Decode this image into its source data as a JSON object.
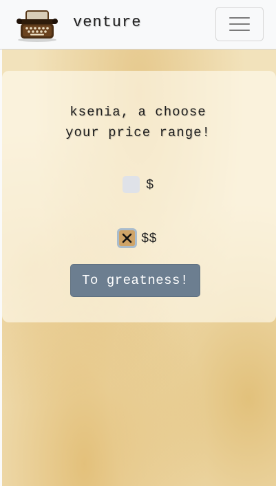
{
  "navbar": {
    "brand": "venture",
    "logo_icon": "typewriter-icon",
    "menu_icon": "hamburger-icon"
  },
  "prompt": {
    "line1": "ksenia, a choose",
    "line2": "your price range!"
  },
  "options": [
    {
      "label": "$",
      "checked": false
    },
    {
      "label": "$$",
      "checked": true
    }
  ],
  "submit_label": "To greatness!",
  "colors": {
    "button": "#6c7e90",
    "checked_fill": "#cfa468",
    "parchment": "#f2e2bb"
  }
}
